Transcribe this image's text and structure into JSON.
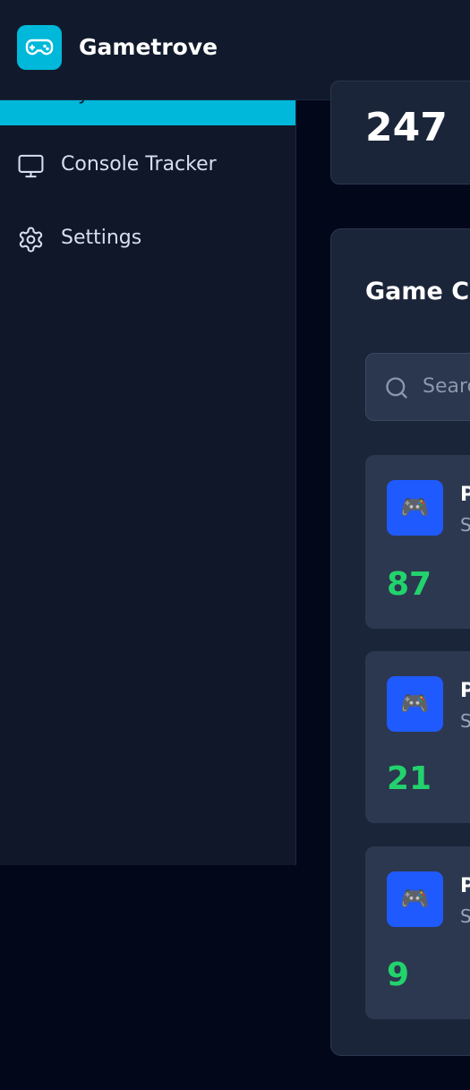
{
  "app": {
    "name": "Gametrove"
  },
  "sidebar": {
    "active_item": {
      "label": "My Collection"
    },
    "items": [
      {
        "label": "Console Tracker",
        "icon": "monitor-icon"
      },
      {
        "label": "Settings",
        "icon": "gear-icon"
      }
    ]
  },
  "stats": {
    "total_value": "247"
  },
  "collection": {
    "title": "Game Collection",
    "search_placeholder": "Search",
    "games": [
      {
        "title": "P",
        "subtitle": "S",
        "count": "87",
        "icon": "gamepad-icon"
      },
      {
        "title": "P",
        "subtitle": "S",
        "count": "21",
        "icon": "gamepad-icon"
      },
      {
        "title": "P",
        "subtitle": "S",
        "count": "9",
        "icon": "gamepad-icon"
      }
    ]
  },
  "colors": {
    "accent": "#00b8d9",
    "thumb": "#1f5aff",
    "count": "#22d36d"
  }
}
